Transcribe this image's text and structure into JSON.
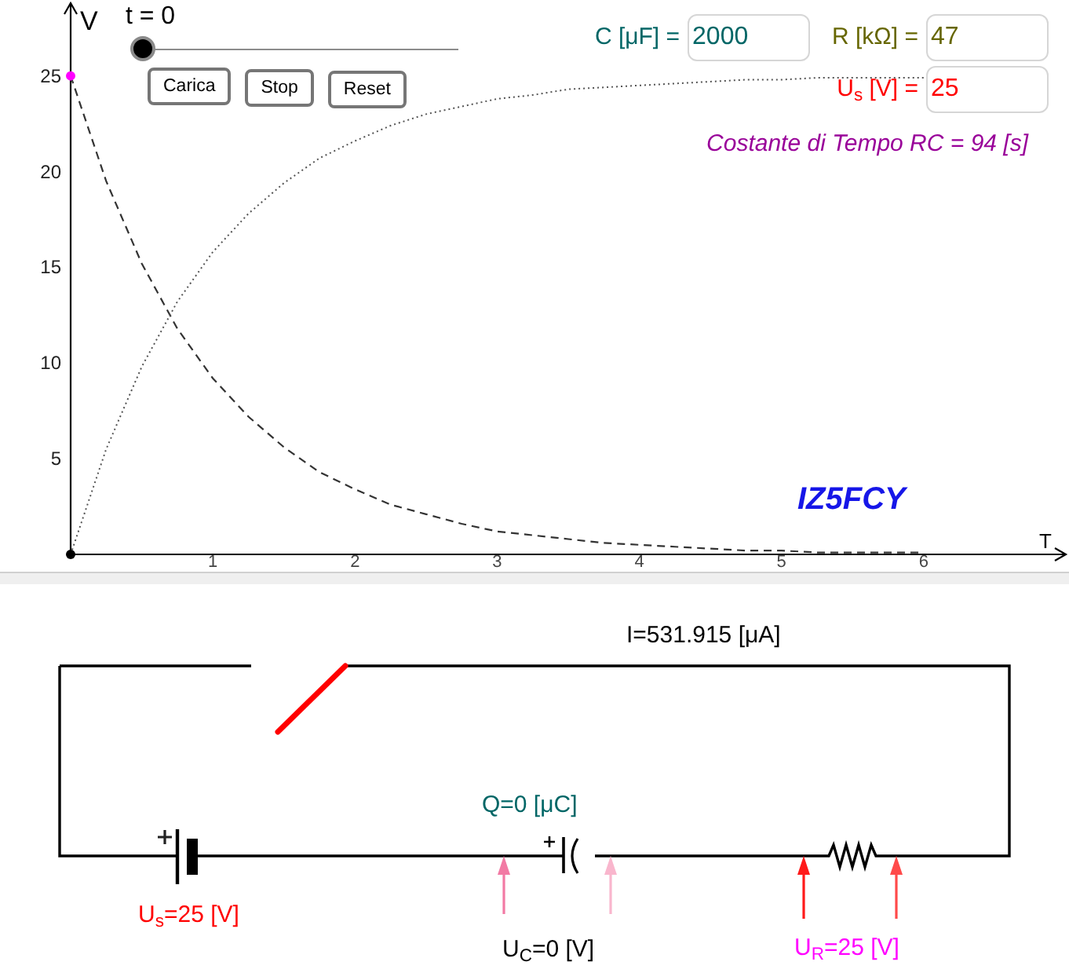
{
  "graph": {
    "slider": {
      "label": "t = 0",
      "level": 0
    },
    "buttons": [
      "Carica",
      "Stop",
      "Reset"
    ],
    "fields": [
      {
        "label": "C [μF] =",
        "value": "2000",
        "color": "#006666"
      },
      {
        "label": "R [kΩ] =",
        "value": "47",
        "color": "#666600"
      },
      {
        "label": "U$_{s}$ [V] =",
        "value": "25",
        "color": "#ff0000"
      }
    ],
    "time_constant": "Costante di Tempo RC = 94 [s]",
    "author_label": "IZ5FCY",
    "points": [
      {
        "color": "#ff00ff"
      },
      {
        "color": "#000000"
      }
    ],
    "chart_data": {
      "type": "line",
      "xlabel": "T",
      "ylabel": "V",
      "x": [
        0,
        0.25,
        0.5,
        0.75,
        1,
        1.25,
        1.5,
        1.75,
        2,
        2.25,
        2.5,
        2.75,
        3,
        3.25,
        3.5,
        3.75,
        4,
        4.25,
        4.5,
        4.75,
        5,
        5.25,
        5.5,
        5.75,
        6
      ],
      "series": [
        {
          "line_style": "dashed",
          "color": "#333333",
          "values": [
            25,
            19.5,
            15.2,
            11.8,
            9.2,
            7.2,
            5.6,
            4.3,
            3.4,
            2.6,
            2.1,
            1.6,
            1.2,
            1,
            0.8,
            0.6,
            0.5,
            0.4,
            0.3,
            0.2,
            0.2,
            0.1,
            0.1,
            0.1,
            0.1
          ]
        },
        {
          "line_style": "dotted",
          "color": "#555555",
          "values": [
            0,
            5.5,
            9.8,
            13.2,
            15.8,
            17.8,
            19.4,
            20.7,
            21.6,
            22.4,
            23,
            23.4,
            23.8,
            24,
            24.3,
            24.4,
            24.5,
            24.6,
            24.7,
            24.8,
            24.8,
            24.9,
            24.9,
            24.9,
            24.9
          ]
        }
      ],
      "xlim": [
        0,
        7
      ],
      "ylim": [
        0,
        28.8
      ],
      "xticks": [
        1,
        2,
        3,
        4,
        5,
        6
      ],
      "yticks": [
        5,
        10,
        15,
        20,
        25
      ]
    }
  },
  "circuit": {
    "current": "I=531.915 [μA]",
    "switch": {
      "closed": false
    },
    "source": {
      "label": "U$_{s}$=25 [V]"
    },
    "capacitor": {
      "charge": "Q=0 [μC]",
      "voltage": "U$_{C}$=0 [V]"
    },
    "resistor": {
      "voltage": "U$_{R}$=25 [V]"
    }
  }
}
